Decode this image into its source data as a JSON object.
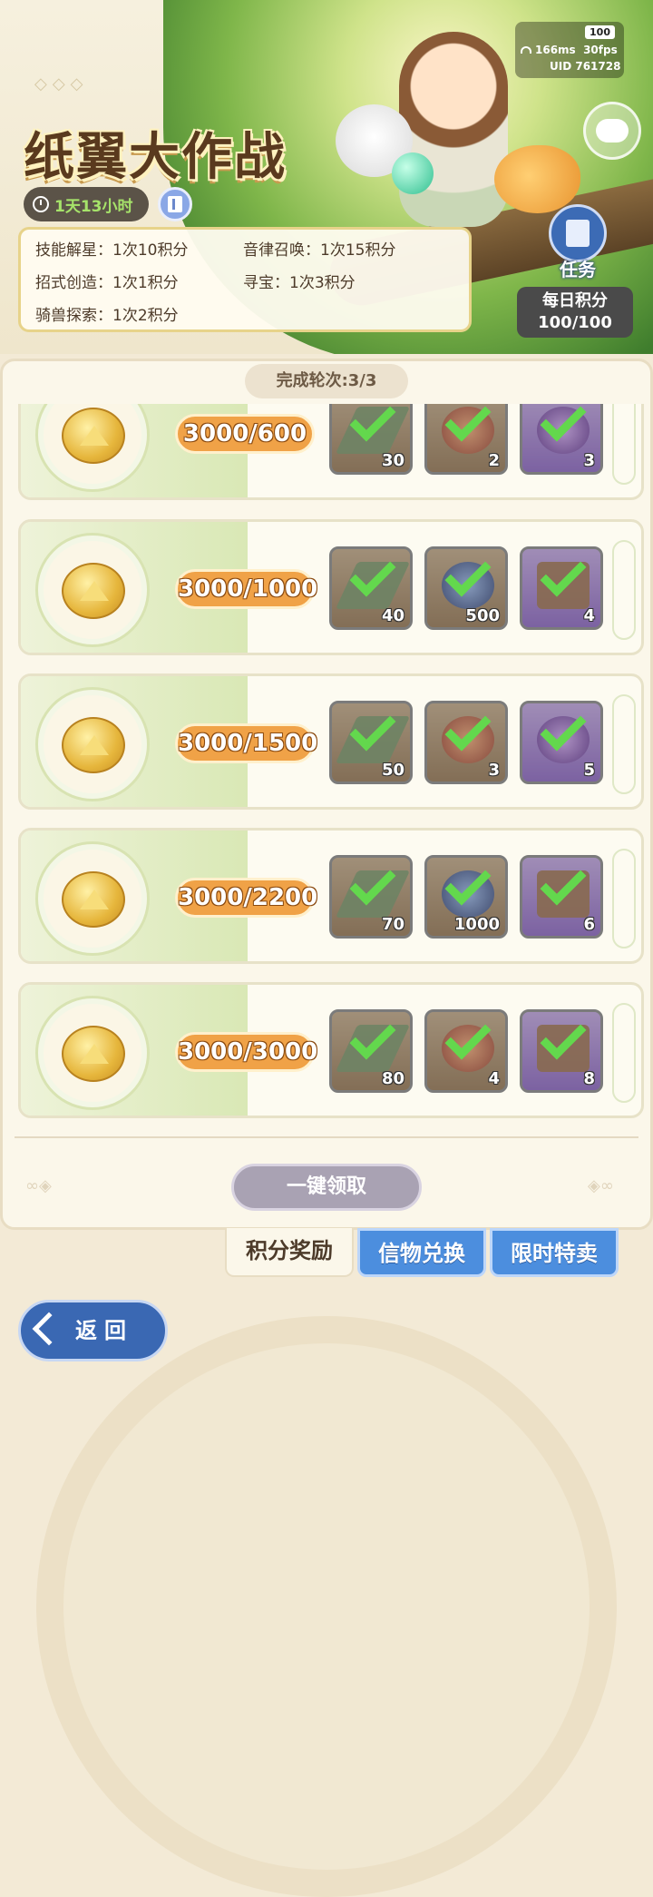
{
  "event": {
    "title": "纸翼大作战",
    "timer": "1天13小时"
  },
  "rules": [
    {
      "name": "技能解星：1次10积分"
    },
    {
      "name": "音律召唤：1次15积分"
    },
    {
      "name": "招式创造：1次1积分"
    },
    {
      "name": "寻宝：1次3积分"
    },
    {
      "name": "骑兽探索：1次2积分"
    }
  ],
  "status": {
    "battery": "100",
    "ping": "166ms",
    "fps": "30fps",
    "uid": "UID 761728"
  },
  "side": {
    "task_label": "任务",
    "daily_label": "每日积分",
    "daily_value": "100/100"
  },
  "round_label": "完成轮次:3/3",
  "tiers": [
    {
      "progress": "3000/600",
      "items": [
        {
          "icon": "paper-plane",
          "qty": "30",
          "claimed": true
        },
        {
          "icon": "exp-orb-red",
          "qty": "2",
          "claimed": true
        },
        {
          "icon": "exp-orb-purple",
          "qty": "3",
          "claimed": true
        }
      ]
    },
    {
      "progress": "3000/1000",
      "items": [
        {
          "icon": "paper-plane",
          "qty": "40",
          "claimed": true
        },
        {
          "icon": "blue-orb",
          "qty": "500",
          "claimed": true
        },
        {
          "icon": "book",
          "qty": "4",
          "claimed": true
        }
      ]
    },
    {
      "progress": "3000/1500",
      "items": [
        {
          "icon": "paper-plane",
          "qty": "50",
          "claimed": true
        },
        {
          "icon": "exp-orb-red",
          "qty": "3",
          "claimed": true
        },
        {
          "icon": "exp-orb-purple",
          "qty": "5",
          "claimed": true
        }
      ]
    },
    {
      "progress": "3000/2200",
      "items": [
        {
          "icon": "paper-plane",
          "qty": "70",
          "claimed": true
        },
        {
          "icon": "blue-orb",
          "qty": "1000",
          "claimed": true
        },
        {
          "icon": "book",
          "qty": "6",
          "claimed": true
        }
      ]
    },
    {
      "progress": "3000/3000",
      "items": [
        {
          "icon": "paper-plane",
          "qty": "80",
          "claimed": true
        },
        {
          "icon": "exp-orb-red",
          "qty": "4",
          "claimed": true
        },
        {
          "icon": "book",
          "qty": "8",
          "claimed": true
        }
      ]
    }
  ],
  "claim_all": "一键领取",
  "tabs": [
    {
      "label": "积分奖励",
      "active": true
    },
    {
      "label": "信物兑换",
      "active": false
    },
    {
      "label": "限时特卖",
      "active": false
    }
  ],
  "back_label": "返回",
  "colors": {
    "progress_pill": "#f0a247",
    "check": "#63d84d",
    "tab_blue": "#4c8ede",
    "title_brown": "#5a3a1e"
  }
}
